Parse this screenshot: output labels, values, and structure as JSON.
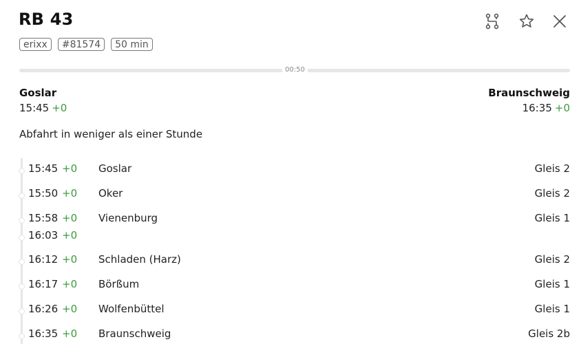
{
  "header": {
    "title": "RB 43",
    "badges": [
      "erixx",
      "#81574",
      "50 min"
    ],
    "icons": [
      "route-icon",
      "star-icon",
      "close-icon"
    ]
  },
  "progress": {
    "label": "00:50",
    "fraction": 0.0
  },
  "origin": {
    "name": "Goslar",
    "time": "15:45",
    "delay": "+0"
  },
  "destination": {
    "name": "Braunschweig",
    "time": "16:35",
    "delay": "+0"
  },
  "notice": "Abfahrt in weniger als einer Stunde",
  "stops": [
    {
      "time": "15:45",
      "delay": "+0",
      "name": "Goslar",
      "platform": "Gleis 2"
    },
    {
      "time": "15:50",
      "delay": "+0",
      "name": "Oker",
      "platform": "Gleis 2"
    },
    {
      "time": "15:58",
      "delay": "+0",
      "name": "Vienenburg",
      "platform": "Gleis 1",
      "departure": "16:03",
      "departure_delay": "+0"
    },
    {
      "time": "16:12",
      "delay": "+0",
      "name": "Schladen (Harz)",
      "platform": "Gleis 2"
    },
    {
      "time": "16:17",
      "delay": "+0",
      "name": "Börßum",
      "platform": "Gleis 1"
    },
    {
      "time": "16:26",
      "delay": "+0",
      "name": "Wolfenbüttel",
      "platform": "Gleis 1"
    },
    {
      "time": "16:35",
      "delay": "+0",
      "name": "Braunschweig",
      "platform": "Gleis 2b"
    }
  ],
  "colors": {
    "delay_green": "#3d9a3d",
    "track": "#e6e6e6"
  }
}
